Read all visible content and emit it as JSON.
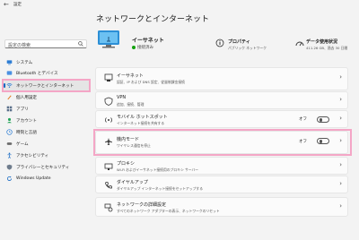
{
  "window": {
    "back": "←",
    "title": "設定"
  },
  "search": {
    "placeholder": "設定の検索"
  },
  "sidebar": {
    "items": [
      {
        "label": "システム",
        "icon": "system-icon"
      },
      {
        "label": "Bluetooth とデバイス",
        "icon": "bluetooth-icon"
      },
      {
        "label": "ネットワークとインターネット",
        "icon": "wifi-icon",
        "active": true
      },
      {
        "label": "個人用設定",
        "icon": "brush-icon"
      },
      {
        "label": "アプリ",
        "icon": "apps-icon"
      },
      {
        "label": "アカウント",
        "icon": "account-icon"
      },
      {
        "label": "時刻と言語",
        "icon": "globe-clock-icon"
      },
      {
        "label": "ゲーム",
        "icon": "gamepad-icon"
      },
      {
        "label": "アクセシビリティ",
        "icon": "accessibility-icon"
      },
      {
        "label": "プライバシーとセキュリティ",
        "icon": "shield-icon"
      },
      {
        "label": "Windows Update",
        "icon": "update-icon"
      }
    ]
  },
  "main": {
    "title": "ネットワークとインターネット",
    "ethernet": {
      "title": "イーサネット",
      "status": "接続済み"
    },
    "properties": {
      "title": "プロパティ",
      "subtitle": "パブリック ネットワーク"
    },
    "usage": {
      "title": "データ使用状況",
      "subtitle": "411.26 GB、過去 30 日間"
    },
    "cards": [
      {
        "title": "イーサネット",
        "subtitle": "認証、IP および DNS 設定、従量制課金接続",
        "icon": "ethernet-icon"
      },
      {
        "title": "VPN",
        "subtitle": "追加、接続、管理",
        "icon": "vpn-shield-icon"
      },
      {
        "title": "モバイル ホットスポット",
        "subtitle": "インターネット接続を共有する",
        "icon": "hotspot-icon",
        "toggle": "オフ"
      },
      {
        "title": "機内モード",
        "subtitle": "ワイヤレス通信を停止",
        "icon": "airplane-icon",
        "toggle": "オフ"
      },
      {
        "title": "プロキシ",
        "subtitle": "Wi-Fi およびイーサネット接続用のプロキシ サーバー",
        "icon": "proxy-icon"
      },
      {
        "title": "ダイヤルアップ",
        "subtitle": "ダイヤルアップ インターネット接続をセットアップする",
        "icon": "phone-icon"
      },
      {
        "title": "ネットワークの詳細設定",
        "subtitle": "すべてのネットワーク アダプターの表示、ネットワークのリセット",
        "icon": "network-advanced-icon"
      }
    ]
  },
  "colors": {
    "accent": "#0067c0",
    "highlight": "#f4a6c6",
    "status_green": "#13a10e"
  }
}
